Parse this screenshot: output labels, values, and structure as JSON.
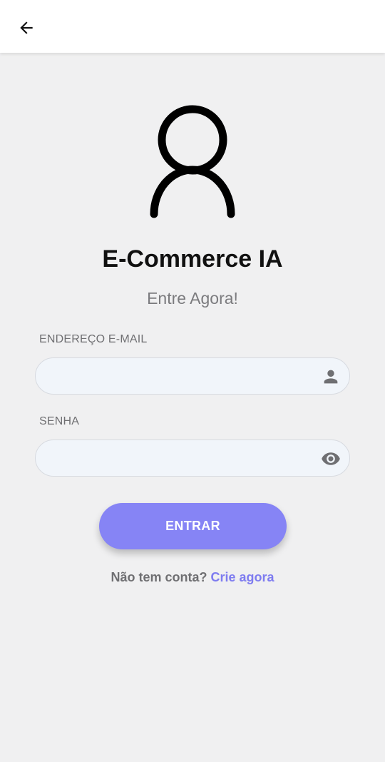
{
  "header": {
    "back_icon": "arrow-left-icon"
  },
  "hero": {
    "avatar_icon": "user-outline-icon",
    "title": "E-Commerce IA",
    "subtitle": "Entre Agora!"
  },
  "form": {
    "email": {
      "label": "ENDEREÇO E-MAIL",
      "value": "",
      "placeholder": "",
      "icon": "person-icon"
    },
    "password": {
      "label": "SENHA",
      "value": "",
      "placeholder": "",
      "icon": "eye-icon"
    },
    "submit_label": "ENTRAR"
  },
  "signup": {
    "prompt": "Não tem conta?",
    "link_label": "Crie agora"
  },
  "colors": {
    "background": "#f0f0f1",
    "primary": "#8684f5",
    "link": "#7e7cf0",
    "field_bg": "#f1f5fa"
  }
}
